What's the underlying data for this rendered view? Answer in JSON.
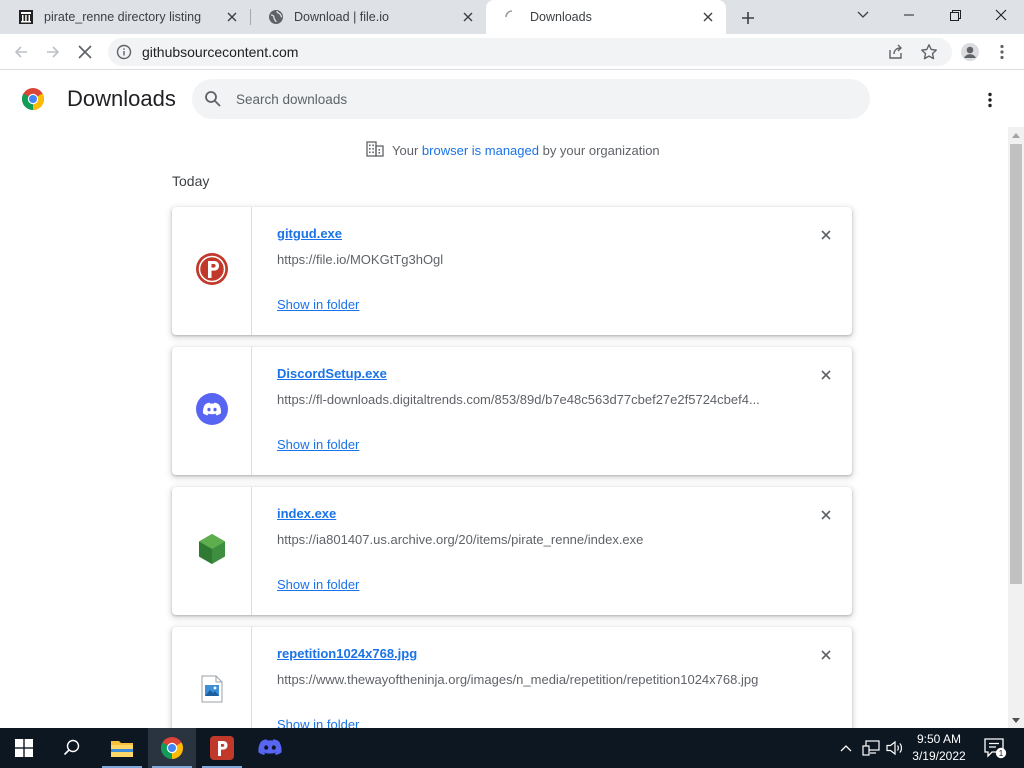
{
  "tabs": [
    {
      "title": "pirate_renne directory listing",
      "favicon": "archive-icon"
    },
    {
      "title": "Download | file.io",
      "favicon": "globe-icon"
    },
    {
      "title": "Downloads",
      "favicon": "loading-spinner-icon",
      "active": true
    }
  ],
  "address_bar": {
    "url": "githubsourcecontent.com"
  },
  "downloads_page": {
    "title": "Downloads",
    "search_placeholder": "Search downloads",
    "managed_notice": {
      "prefix": "Your",
      "link": "browser is managed",
      "suffix": "by your organization"
    },
    "section_date": "Today",
    "show_in_folder_label": "Show in folder",
    "items": [
      {
        "filename": "gitgud.exe",
        "url": "https://file.io/MOKGtTg3hOgl",
        "icon": "psiphon-p-icon",
        "action": "Show in folder"
      },
      {
        "filename": "DiscordSetup.exe",
        "url": "https://fl-downloads.digitaltrends.com/853/89d/b7e48c563d77cbef27e2f5724cbef4...",
        "icon": "discord-icon",
        "action": "Show in folder"
      },
      {
        "filename": "index.exe",
        "url": "https://ia801407.us.archive.org/20/items/pirate_renne/index.exe",
        "icon": "green-cube-icon",
        "action": "Show in folder"
      },
      {
        "filename": "repetition1024x768.jpg",
        "url": "https://www.thewayoftheninja.org/images/n_media/repetition/repetition1024x768.jpg",
        "icon": "image-file-icon",
        "action": "Show in folder"
      }
    ]
  },
  "taskbar": {
    "pinned": [
      "windows-start-icon",
      "search-icon",
      "file-explorer-icon",
      "chrome-icon",
      "psiphon-icon",
      "discord-icon"
    ],
    "clock_time": "9:50 AM",
    "clock_date": "3/19/2022",
    "notification_count": "1"
  },
  "colors": {
    "link": "#1a73e8",
    "tabstrip": "#dee1e6",
    "taskbar": "#0d1722"
  }
}
